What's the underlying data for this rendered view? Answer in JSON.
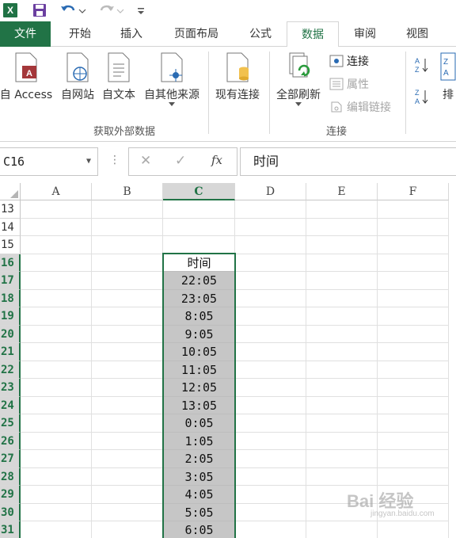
{
  "qat": {
    "app_icon": "X",
    "icons": [
      "excel-logo-icon",
      "save-icon",
      "undo-icon",
      "redo-icon",
      "customize-icon"
    ]
  },
  "tabs": [
    {
      "label": "文件"
    },
    {
      "label": "开始"
    },
    {
      "label": "插入"
    },
    {
      "label": "页面布局"
    },
    {
      "label": "公式"
    },
    {
      "label": "数据"
    },
    {
      "label": "审阅"
    },
    {
      "label": "视图"
    }
  ],
  "ribbon": {
    "get_external": {
      "access": "自 Access",
      "web": "自网站",
      "text": "自文本",
      "other": "自其他来源",
      "existing": "现有连接",
      "group_label": "获取外部数据"
    },
    "connections": {
      "refresh_all": "全部刷新",
      "connections": "连接",
      "properties": "属性",
      "edit_links": "编辑链接",
      "group_label": "连接"
    },
    "sort": {
      "sort_label": "排"
    }
  },
  "formula_bar": {
    "name_box": "C16",
    "fx": "fx",
    "content": "时间"
  },
  "grid": {
    "columns": [
      "A",
      "B",
      "C",
      "D",
      "E",
      "F"
    ],
    "rows": [
      "13",
      "14",
      "15",
      "16",
      "17",
      "18",
      "19",
      "20",
      "21",
      "22",
      "23",
      "24",
      "25",
      "26",
      "27",
      "28",
      "29",
      "30",
      "31"
    ],
    "column_c": [
      "时间",
      "22:05",
      "23:05",
      "8:05",
      "9:05",
      "10:05",
      "11:05",
      "12:05",
      "13:05",
      "0:05",
      "1:05",
      "2:05",
      "3:05",
      "4:05",
      "5:05",
      "6:05"
    ]
  },
  "watermark": {
    "text": "Bai 经验",
    "sub": "jingyan.baidu.com"
  },
  "colors": {
    "excel_green": "#217346",
    "selection_fill": "#c6c6c6"
  }
}
